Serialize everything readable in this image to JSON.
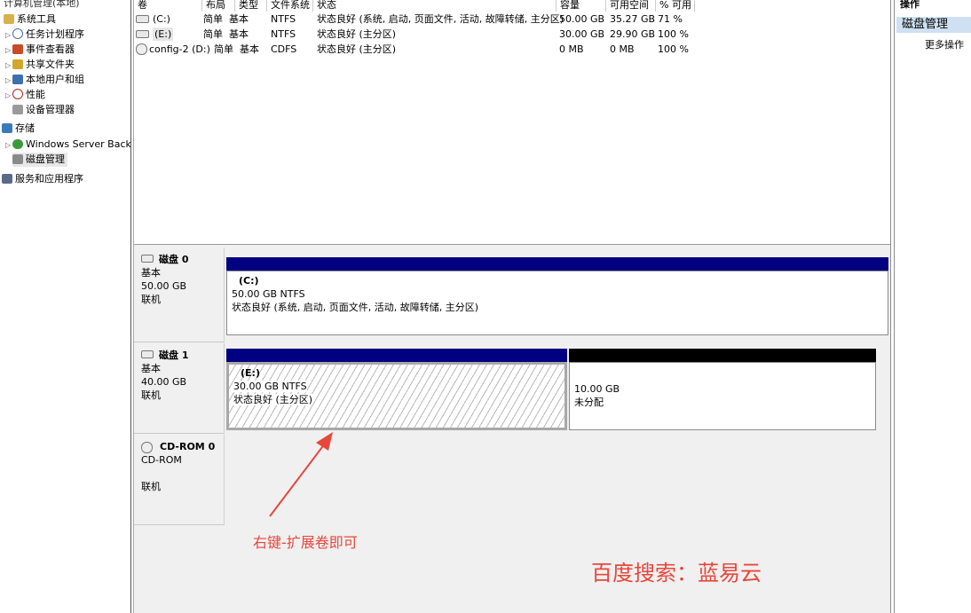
{
  "tree": {
    "root": "计算机管理(本地)",
    "items": [
      {
        "label": "系统工具",
        "icon": "tools-icon",
        "color": "#b88a2a"
      },
      {
        "label": "任务计划程序",
        "icon": "clock-icon",
        "color": "#4a6fb5"
      },
      {
        "label": "事件查看器",
        "icon": "event-viewer-icon",
        "color": "#c94a2a"
      },
      {
        "label": "共享文件夹",
        "icon": "shared-folder-icon",
        "color": "#d4a52a"
      },
      {
        "label": "本地用户和组",
        "icon": "users-icon",
        "color": "#3d6fb0"
      },
      {
        "label": "性能",
        "icon": "performance-icon",
        "color": "#c02020"
      },
      {
        "label": "设备管理器",
        "icon": "device-manager-icon",
        "color": "#7a7a7a"
      },
      {
        "label": "存储",
        "icon": "storage-icon",
        "color": "#3a7ab8"
      },
      {
        "label": "Windows Server Back",
        "icon": "backup-icon",
        "color": "#3a9a3a"
      },
      {
        "label": "磁盘管理",
        "icon": "disk-management-icon",
        "color": "#6a6a6a"
      },
      {
        "label": "服务和应用程序",
        "icon": "services-icon",
        "color": "#5a6a8a"
      }
    ]
  },
  "volumes": {
    "headers": [
      "卷",
      "布局",
      "类型",
      "文件系统",
      "状态",
      "容量",
      "可用空间",
      "% 可用"
    ],
    "rows": [
      [
        "(C:)",
        "简单",
        "基本",
        "NTFS",
        "状态良好 (系统, 启动, 页面文件, 活动, 故障转储, 主分区)",
        "50.00 GB",
        "35.27 GB",
        "71 %"
      ],
      [
        "(E:)",
        "简单",
        "基本",
        "NTFS",
        "状态良好 (主分区)",
        "30.00 GB",
        "29.90 GB",
        "100 %"
      ],
      [
        "config-2 (D:)",
        "简单",
        "基本",
        "CDFS",
        "状态良好 (主分区)",
        "0 MB",
        "0 MB",
        "100 %"
      ]
    ]
  },
  "disks": {
    "disk0": {
      "name": "磁盘 0",
      "type": "基本",
      "size": "50.00 GB",
      "state": "联机",
      "part": {
        "name": "(C:)",
        "size": "50.00 GB NTFS",
        "status": "状态良好 (系统, 启动, 页面文件, 活动, 故障转储, 主分区)"
      }
    },
    "disk1": {
      "name": "磁盘 1",
      "type": "基本",
      "size": "40.00 GB",
      "state": "联机",
      "part": {
        "name": "(E:)",
        "size": "30.00 GB NTFS",
        "status": "状态良好 (主分区)"
      },
      "unalloc": {
        "size": "10.00 GB",
        "status": "未分配"
      }
    },
    "cdrom": {
      "name": "CD-ROM 0",
      "type": "CD-ROM",
      "state": "联机"
    }
  },
  "actions": {
    "header": "操作",
    "section": "磁盘管理",
    "more": "更多操作"
  },
  "annotations": {
    "arrow_text": "右键-扩展卷即可",
    "watermark": "百度搜索：蓝易云"
  },
  "colors": {
    "primary_bar": "#000080",
    "unallocated_bar": "#000000",
    "annotation": "#e8473b",
    "action_highlight": "#cfe0f3"
  }
}
